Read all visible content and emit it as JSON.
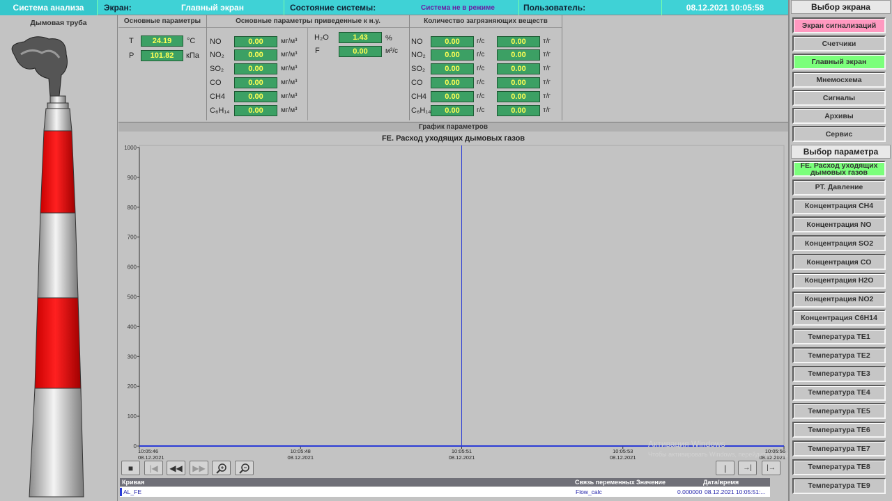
{
  "topbar": {
    "system": "Система анализа",
    "screen_label": "Экран:",
    "screen_value": "Главный экран",
    "state_label": "Состояние системы:",
    "state_value": "Система не в режиме",
    "user_label": "Пользователь:",
    "datetime": "08.12.2021 10:05:58"
  },
  "left": {
    "title": "Дымовая труба"
  },
  "basic": {
    "title": "Основные параметры",
    "rows": [
      {
        "label": "T",
        "value": "24.19",
        "unit": "°C"
      },
      {
        "label": "P",
        "value": "101.82",
        "unit": "кПа"
      }
    ]
  },
  "normalized": {
    "title": "Основные параметры приведенные к н.у.",
    "rows": [
      {
        "label": "NO",
        "value": "0.00",
        "unit": "мг/м³"
      },
      {
        "label": "NO₂",
        "value": "0.00",
        "unit": "мг/м³"
      },
      {
        "label": "SO₂",
        "value": "0.00",
        "unit": "мг/м³"
      },
      {
        "label": "CO",
        "value": "0.00",
        "unit": "мг/м³"
      },
      {
        "label": "CH4",
        "value": "0.00",
        "unit": "мг/м³"
      },
      {
        "label": "C₆H₁₄",
        "value": "0.00",
        "unit": "мг/м³"
      }
    ],
    "extra": [
      {
        "label": "H₂O",
        "value": "1.43",
        "unit": "%"
      },
      {
        "label": "F",
        "value": "0.00",
        "unit": "м³/с"
      }
    ]
  },
  "pollutants": {
    "title": "Количество загрязняющих веществ",
    "rows": [
      {
        "label": "NO",
        "v1": "0.00",
        "u1": "г/с",
        "v2": "0.00",
        "u2": "т/г"
      },
      {
        "label": "NO₂",
        "v1": "0.00",
        "u1": "г/с",
        "v2": "0.00",
        "u2": "т/г"
      },
      {
        "label": "SO₂",
        "v1": "0.00",
        "u1": "г/с",
        "v2": "0.00",
        "u2": "т/г"
      },
      {
        "label": "CO",
        "v1": "0.00",
        "u1": "г/с",
        "v2": "0.00",
        "u2": "т/г"
      },
      {
        "label": "CH4",
        "v1": "0.00",
        "u1": "г/с",
        "v2": "0.00",
        "u2": "т/г"
      },
      {
        "label": "C₆H₁₄",
        "v1": "0.00",
        "u1": "г/с",
        "v2": "0.00",
        "u2": "т/г"
      }
    ]
  },
  "chart_section": "График параметров",
  "chart_data": {
    "type": "line",
    "title": "FE. Расход уходящих дымовых газов",
    "ylim": [
      0,
      1000
    ],
    "yticks": [
      "0",
      "100",
      "200",
      "300",
      "400",
      "500",
      "600",
      "700",
      "800",
      "900",
      "1000"
    ],
    "xticks": [
      {
        "time": "10:05:46",
        "date": "08.12.2021"
      },
      {
        "time": "10:05:48",
        "date": "08.12.2021"
      },
      {
        "time": "10:05:51",
        "date": "08.12.2021"
      },
      {
        "time": "10:05:53",
        "date": "08.12.2021"
      },
      {
        "time": "10:05:56",
        "date": "08.12.2021"
      }
    ],
    "cursor_time": "10:05:51",
    "series": [
      {
        "name": "AL_FE",
        "color": "#2a3bd6",
        "values": [
          0,
          0,
          0,
          0,
          0
        ]
      }
    ],
    "grid": false
  },
  "controls": {
    "left": [
      "stop-icon",
      "first-icon",
      "rewind-icon",
      "forward-icon",
      "zoom-in-icon",
      "zoom-out-icon"
    ],
    "right": [
      "ruler-icon",
      "ruler-left-icon",
      "ruler-right-icon"
    ]
  },
  "table": {
    "headers": [
      "Кривая",
      "Связь переменных",
      "Значение",
      "Дата/время"
    ],
    "rows": [
      [
        "AL_FE",
        "Flow_calc",
        "0.000000",
        "08.12.2021 10:05:51:..."
      ]
    ]
  },
  "watermark": [
    "Активация Windows",
    "Чтобы активировать Windows, перейдите в раздел"
  ],
  "screen_select": {
    "title": "Выбор экрана",
    "items": [
      {
        "label": "Экран сигнализаций",
        "state": "pink"
      },
      {
        "label": "Счетчики",
        "state": ""
      },
      {
        "label": "Главный экран",
        "state": "green"
      },
      {
        "label": "Мнемосхема",
        "state": ""
      },
      {
        "label": "Сигналы",
        "state": ""
      },
      {
        "label": "Архивы",
        "state": ""
      },
      {
        "label": "Сервис",
        "state": ""
      }
    ]
  },
  "param_select": {
    "title": "Выбор параметра",
    "items": [
      {
        "label": "FE. Расход уходящих дымовых газов",
        "state": "green"
      },
      {
        "label": "PT. Давление",
        "state": ""
      },
      {
        "label": "Концентрация CH4",
        "state": ""
      },
      {
        "label": "Концентрация NO",
        "state": ""
      },
      {
        "label": "Концентрация SO2",
        "state": ""
      },
      {
        "label": "Концентрация CO",
        "state": ""
      },
      {
        "label": "Концентрация H2O",
        "state": ""
      },
      {
        "label": "Концентрация NO2",
        "state": ""
      },
      {
        "label": "Концентрация C6H14",
        "state": ""
      },
      {
        "label": "Температура TE1",
        "state": ""
      },
      {
        "label": "Температура TE2",
        "state": ""
      },
      {
        "label": "Температура TE3",
        "state": ""
      },
      {
        "label": "Температура TE4",
        "state": ""
      },
      {
        "label": "Температура TE5",
        "state": ""
      },
      {
        "label": "Температура TE6",
        "state": ""
      },
      {
        "label": "Температура TE7",
        "state": ""
      },
      {
        "label": "Температура TE8",
        "state": ""
      },
      {
        "label": "Температура TE9",
        "state": ""
      }
    ]
  }
}
